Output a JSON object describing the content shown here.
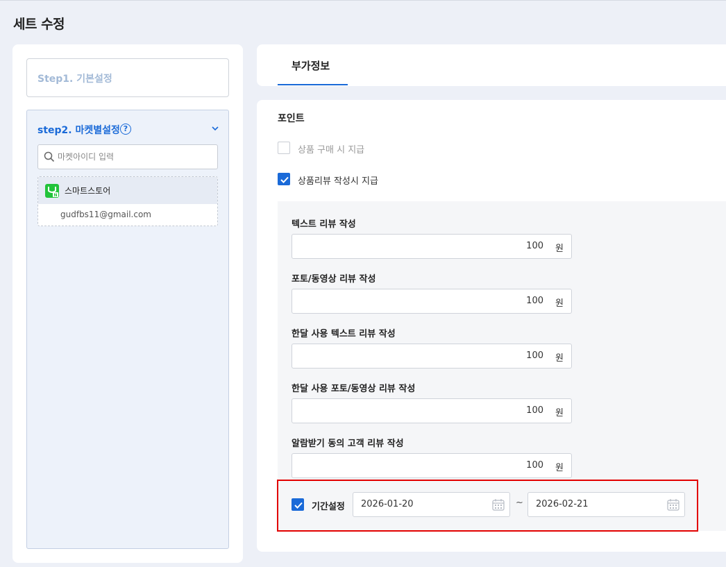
{
  "page": {
    "title": "세트 수정"
  },
  "sidebar": {
    "step1_label": "Step1. 기본설정",
    "step2_label": "step2. 마켓별설정",
    "help_glyph": "?",
    "search_placeholder": "마켓아이디 입력",
    "markets": [
      {
        "name": "스마트스토어",
        "account": "gudfbs11@gmail.com",
        "icon": "naver-smartstore-icon"
      }
    ]
  },
  "tabs": [
    {
      "label": "부가정보",
      "active": true
    }
  ],
  "points": {
    "section_title": "포인트",
    "options": [
      {
        "label": "상품 구매 시 지급",
        "checked": false
      },
      {
        "label": "상품리뷰 작성시 지급",
        "checked": true
      }
    ],
    "fields": [
      {
        "label": "텍스트 리뷰 작성",
        "value": "100",
        "unit": "원"
      },
      {
        "label": "포토/동영상 리뷰 작성",
        "value": "100",
        "unit": "원"
      },
      {
        "label": "한달 사용 텍스트 리뷰 작성",
        "value": "100",
        "unit": "원"
      },
      {
        "label": "한달 사용 포토/동영상 리뷰 작성",
        "value": "100",
        "unit": "원"
      },
      {
        "label": "알람받기 동의 고객 리뷰 작성",
        "value": "100",
        "unit": "원"
      }
    ],
    "period": {
      "label": "기간설정",
      "checked": true,
      "start": "2026-01-20",
      "end": "2026-02-21",
      "separator": "~"
    }
  },
  "colors": {
    "accent": "#1a6ad8",
    "highlight": "#e20000",
    "background": "#edf0f7"
  }
}
